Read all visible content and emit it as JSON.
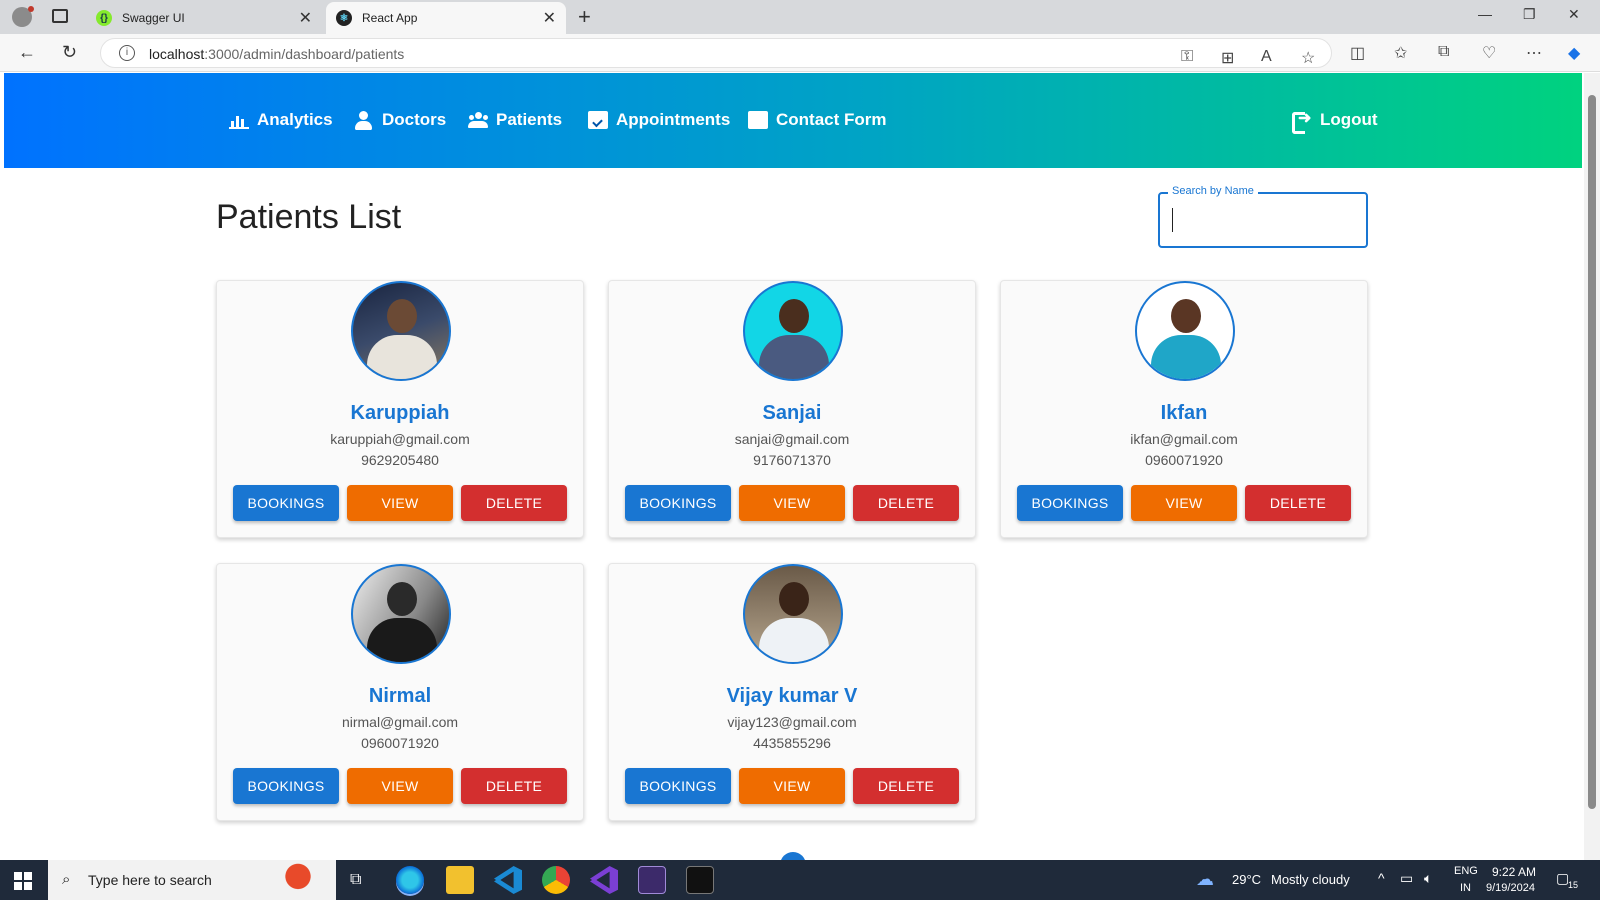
{
  "browser": {
    "tabs": [
      {
        "title": "Swagger UI",
        "active": false
      },
      {
        "title": "React App",
        "active": true
      }
    ],
    "url_host": "localhost",
    "url_rest": ":3000/admin/dashboard/patients"
  },
  "nav": {
    "items": [
      {
        "label": "Analytics",
        "icon": "bar-chart-icon"
      },
      {
        "label": "Doctors",
        "icon": "doctor-icon"
      },
      {
        "label": "Patients",
        "icon": "users-icon"
      },
      {
        "label": "Appointments",
        "icon": "calendar-check-icon"
      },
      {
        "label": "Contact Form",
        "icon": "envelope-open-icon"
      }
    ],
    "logout": "Logout"
  },
  "page": {
    "title": "Patients List",
    "search_label": "Search by Name",
    "search_value": ""
  },
  "patients": [
    {
      "name": "Karuppiah",
      "email": "karuppiah@gmail.com",
      "phone": "9629205480"
    },
    {
      "name": "Sanjai",
      "email": "sanjai@gmail.com",
      "phone": "9176071370"
    },
    {
      "name": "Ikfan",
      "email": "ikfan@gmail.com",
      "phone": "0960071920"
    },
    {
      "name": "Nirmal",
      "email": "nirmal@gmail.com",
      "phone": "0960071920"
    },
    {
      "name": "Vijay kumar V",
      "email": "vijay123@gmail.com",
      "phone": "4435855296"
    }
  ],
  "buttons": {
    "bookings": "BOOKINGS",
    "view": "VIEW",
    "delete": "DELETE"
  },
  "taskbar": {
    "search_placeholder": "Type here to search",
    "weather_temp": "29°C",
    "weather_text": "Mostly cloudy",
    "lang": "ENG",
    "region": "IN",
    "time": "9:22 AM",
    "date": "9/19/2024",
    "notifications": "15"
  },
  "colors": {
    "primary": "#1976d2",
    "view": "#ef6c00",
    "delete": "#d32f2f"
  }
}
